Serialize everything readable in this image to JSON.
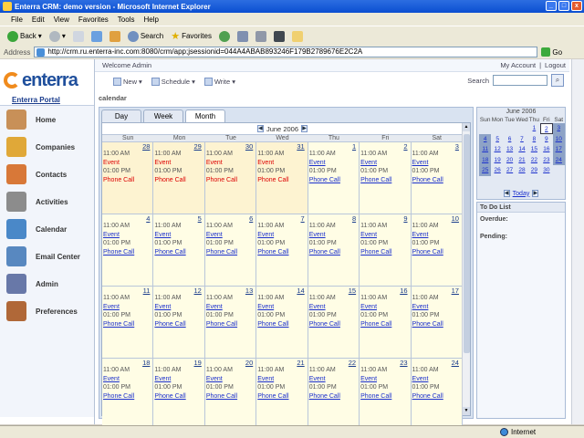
{
  "window": {
    "title": "Enterra CRM: demo version - Microsoft Internet Explorer"
  },
  "menu": [
    "File",
    "Edit",
    "View",
    "Favorites",
    "Tools",
    "Help"
  ],
  "toolbar": {
    "back": "Back",
    "search": "Search",
    "favorites": "Favorites"
  },
  "address": {
    "label": "Address",
    "url": "http://crm.ru.enterra-inc.com:8080/crm/app;jsessionid=044A4ABAB893246F179B2789676E2C2A",
    "go": "Go"
  },
  "app": {
    "logo": "enterra",
    "portal": "Enterra Portal",
    "welcome": "Welcome Admin",
    "my_account": "My Account",
    "sep": "|",
    "logout": "Logout",
    "actions": [
      "New",
      "Schedule",
      "Write"
    ],
    "search_label": "Search",
    "section": "calendar"
  },
  "nav": [
    "Home",
    "Companies",
    "Contacts",
    "Activities",
    "Calendar",
    "Email Center",
    "Admin",
    "Preferences"
  ],
  "calendar": {
    "tabs": [
      "Day",
      "Week",
      "Month"
    ],
    "active_tab": "Month",
    "month": "June 2006",
    "days": [
      "Sun",
      "Mon",
      "Tue",
      "Wed",
      "Thu",
      "Fri",
      "Sat"
    ],
    "weeks": [
      [
        {
          "d": "28",
          "prev": true
        },
        {
          "d": "29",
          "prev": true
        },
        {
          "d": "30",
          "prev": true
        },
        {
          "d": "31",
          "prev": true
        },
        {
          "d": "1"
        },
        {
          "d": "2"
        },
        {
          "d": "3"
        }
      ],
      [
        {
          "d": "4"
        },
        {
          "d": "5"
        },
        {
          "d": "6"
        },
        {
          "d": "7"
        },
        {
          "d": "8"
        },
        {
          "d": "9"
        },
        {
          "d": "10"
        }
      ],
      [
        {
          "d": "11"
        },
        {
          "d": "12"
        },
        {
          "d": "13"
        },
        {
          "d": "14"
        },
        {
          "d": "15"
        },
        {
          "d": "16"
        },
        {
          "d": "17"
        }
      ],
      [
        {
          "d": "18"
        },
        {
          "d": "19"
        },
        {
          "d": "20"
        },
        {
          "d": "21"
        },
        {
          "d": "22"
        },
        {
          "d": "23"
        },
        {
          "d": "24"
        }
      ]
    ],
    "entry": {
      "t1": "11:00 AM",
      "e1": "Event",
      "t2": "01:00 PM",
      "e2": "Phone Call"
    }
  },
  "mini": {
    "title": "June 2006",
    "days": [
      "Sun",
      "Mon",
      "Tue",
      "Wed",
      "Thu",
      "Fri",
      "Sat"
    ],
    "rows": [
      [
        "",
        "",
        "",
        "",
        "1",
        "2",
        "3"
      ],
      [
        "4",
        "5",
        "6",
        "7",
        "8",
        "9",
        "10"
      ],
      [
        "11",
        "12",
        "13",
        "14",
        "15",
        "16",
        "17"
      ],
      [
        "18",
        "19",
        "20",
        "21",
        "22",
        "23",
        "24"
      ],
      [
        "25",
        "26",
        "27",
        "28",
        "29",
        "30",
        ""
      ]
    ],
    "today": "Today",
    "selected": "2"
  },
  "todo": {
    "title": "To Do List",
    "overdue": "Overdue:",
    "pending": "Pending:"
  },
  "status": {
    "zone": "Internet"
  }
}
